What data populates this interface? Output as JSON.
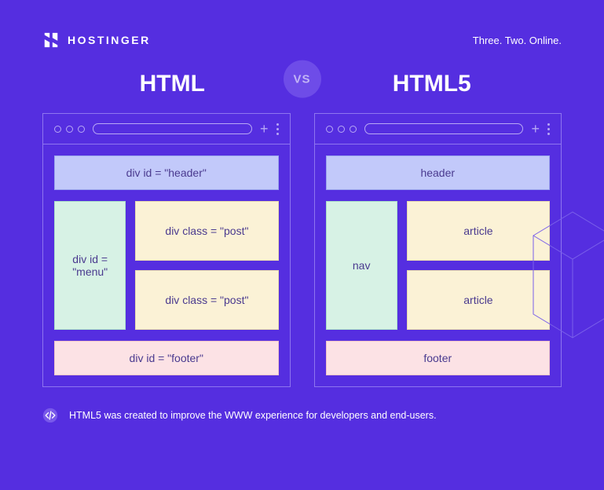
{
  "header": {
    "brand": "HOSTINGER",
    "tagline": "Three. Two. Online."
  },
  "comparison": {
    "left_title": "HTML",
    "right_title": "HTML5",
    "vs_label": "VS"
  },
  "left_panel": {
    "header": "div id = \"header\"",
    "nav": "div id = \"menu\"",
    "article1": "div class = \"post\"",
    "article2": "div class = \"post\"",
    "footer": "div id = \"footer\""
  },
  "right_panel": {
    "header": "header",
    "nav": "nav",
    "article1": "article",
    "article2": "article",
    "footer": "footer"
  },
  "caption": "HTML5 was created to improve the WWW experience for developers and end-users."
}
